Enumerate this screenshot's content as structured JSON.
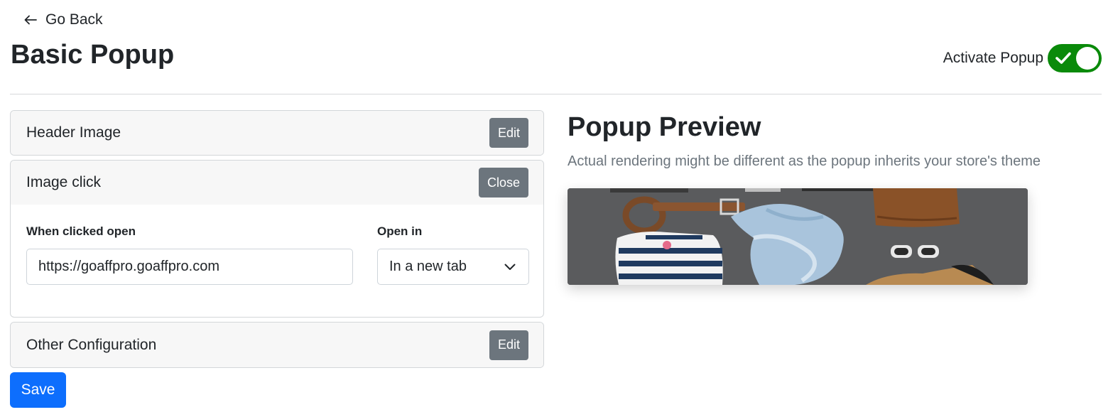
{
  "nav": {
    "back_label": "Go Back"
  },
  "page": {
    "title": "Basic Popup"
  },
  "activate": {
    "label": "Activate Popup",
    "enabled": true,
    "color": "#0a8a0a"
  },
  "sections": {
    "header_image": {
      "title": "Header Image",
      "button": "Edit"
    },
    "image_click": {
      "title": "Image click",
      "button": "Close",
      "open_label": "When clicked open",
      "url_value": "https://goaffpro.goaffpro.com",
      "open_in_label": "Open in",
      "open_in_value": "In a new tab"
    },
    "other_config": {
      "title": "Other Configuration",
      "button": "Edit"
    }
  },
  "save": {
    "label": "Save",
    "color": "#0d6efd"
  },
  "preview": {
    "title": "Popup Preview",
    "subtitle": "Actual rendering might be different as the popup inherits your store's theme"
  }
}
